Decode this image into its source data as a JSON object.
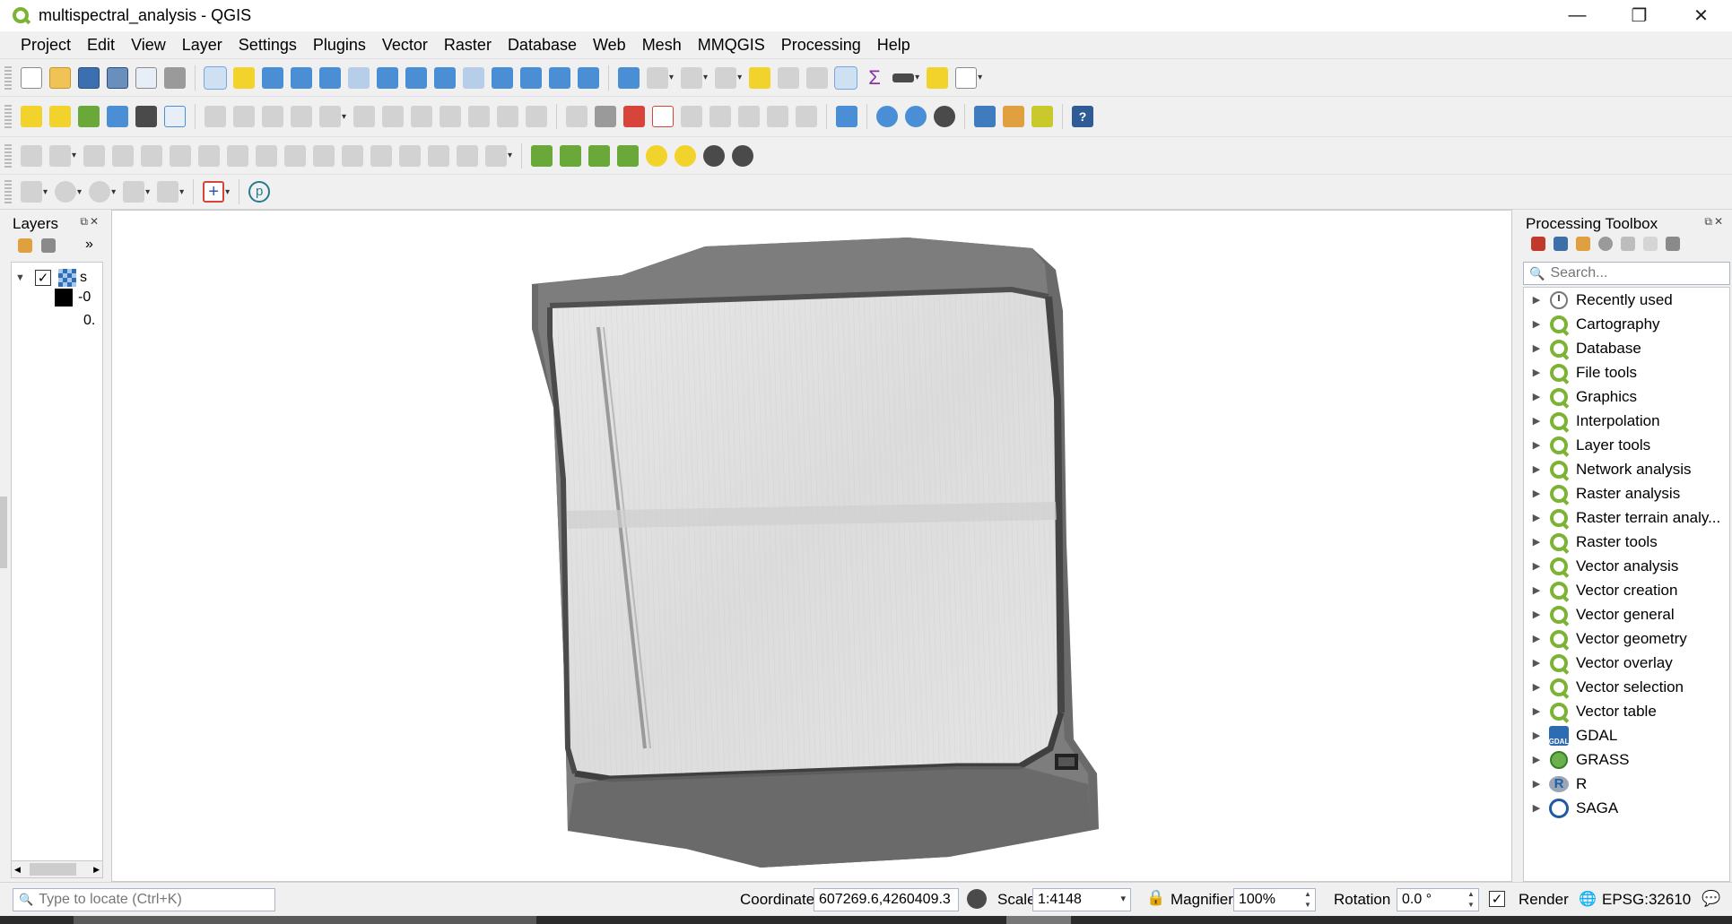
{
  "window": {
    "title": "multispectral_analysis - QGIS",
    "controls": [
      "minimize",
      "restore",
      "close"
    ]
  },
  "menubar": {
    "items": [
      "Project",
      "Edit",
      "View",
      "Layer",
      "Settings",
      "Plugins",
      "Vector",
      "Raster",
      "Database",
      "Web",
      "Mesh",
      "MMQGIS",
      "Processing",
      "Help"
    ]
  },
  "layers_panel": {
    "title": "Layers",
    "more_glyph": "»",
    "layer": {
      "name": "s",
      "checked": true
    },
    "legend": [
      {
        "swatch_color": "#000000",
        "label": "-0"
      },
      {
        "label": "0."
      }
    ]
  },
  "processing_toolbox": {
    "title": "Processing Toolbox",
    "search": {
      "placeholder": "Search..."
    },
    "providers": [
      {
        "label": "Recently used",
        "icon": "clock-icon"
      },
      {
        "label": "Cartography",
        "icon": "qgis-icon"
      },
      {
        "label": "Database",
        "icon": "qgis-icon"
      },
      {
        "label": "File tools",
        "icon": "qgis-icon"
      },
      {
        "label": "Graphics",
        "icon": "qgis-icon"
      },
      {
        "label": "Interpolation",
        "icon": "qgis-icon"
      },
      {
        "label": "Layer tools",
        "icon": "qgis-icon"
      },
      {
        "label": "Network analysis",
        "icon": "qgis-icon"
      },
      {
        "label": "Raster analysis",
        "icon": "qgis-icon"
      },
      {
        "label": "Raster terrain analy...",
        "icon": "qgis-icon"
      },
      {
        "label": "Raster tools",
        "icon": "qgis-icon"
      },
      {
        "label": "Vector analysis",
        "icon": "qgis-icon"
      },
      {
        "label": "Vector creation",
        "icon": "qgis-icon"
      },
      {
        "label": "Vector general",
        "icon": "qgis-icon"
      },
      {
        "label": "Vector geometry",
        "icon": "qgis-icon"
      },
      {
        "label": "Vector overlay",
        "icon": "qgis-icon"
      },
      {
        "label": "Vector selection",
        "icon": "qgis-icon"
      },
      {
        "label": "Vector table",
        "icon": "qgis-icon"
      },
      {
        "label": "GDAL",
        "icon": "gdal-icon"
      },
      {
        "label": "GRASS",
        "icon": "grass-icon"
      },
      {
        "label": "R",
        "icon": "r-icon"
      },
      {
        "label": "SAGA",
        "icon": "saga-icon"
      }
    ]
  },
  "statusbar": {
    "locator_placeholder": "Type to locate (Ctrl+K)",
    "coordinate_label": "Coordinate",
    "coordinate_value": "607269.6,4260409.3",
    "scale_label": "Scale",
    "scale_value": "1:4148",
    "magnifier_label": "Magnifier",
    "magnifier_value": "100%",
    "rotation_label": "Rotation",
    "rotation_value": "0.0 °",
    "render_label": "Render",
    "render_checked": true,
    "crs": "EPSG:32610"
  },
  "icon_glyphs": {
    "sigma": "Σ",
    "help": "?",
    "plus": "+",
    "p": "p",
    "check": "✓",
    "expand": "▶",
    "collapse": "▼",
    "dropdown": "▾",
    "minimize": "—",
    "restore": "❐",
    "close": "✕",
    "search": "🔍",
    "lock": "🔒",
    "globe": "🌐",
    "chat": "💬"
  }
}
